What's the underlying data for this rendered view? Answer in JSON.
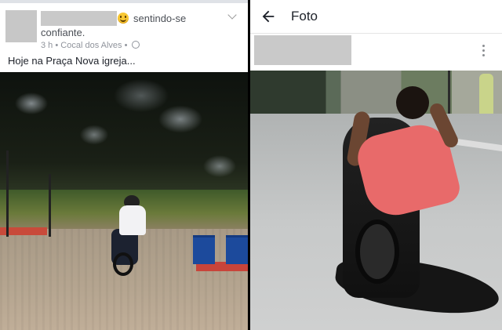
{
  "left_post": {
    "feeling_text": "sentindo-se",
    "feeling_text_line2": "confiante.",
    "time": "3 h",
    "separator": "•",
    "location": "Cocal dos Alves",
    "separator2": "•",
    "caption": "Hoje na Praça Nova igreja...",
    "emoji_icon": "smiley-emoji-icon",
    "privacy_icon": "globe-icon",
    "menu_icon": "chevron-down-icon"
  },
  "right_viewer": {
    "title": "Foto",
    "back_icon": "arrow-left-icon",
    "more_icon": "more-vertical-icon"
  },
  "colors": {
    "text_primary": "#1d2129",
    "text_secondary": "#4b4f56",
    "text_meta": "#90949c",
    "redaction": "#c9c9c9",
    "shirt": "#e86a6a"
  }
}
